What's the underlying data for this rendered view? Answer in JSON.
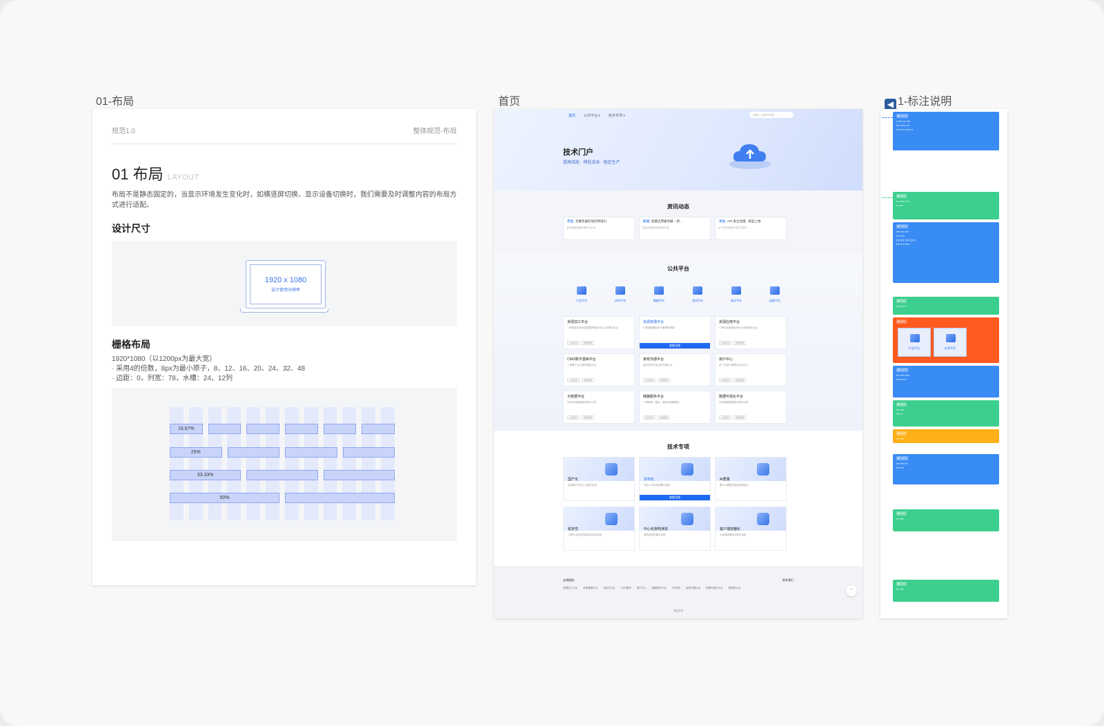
{
  "frames": {
    "layout_title": "01-布局",
    "home_title": "首页",
    "notes_title": "1-标注说明"
  },
  "layout": {
    "version": "规范1.0",
    "breadcrumb": "整体规范-布局",
    "heading": "01 布局",
    "heading_en": "LAYOUT",
    "description": "布局不是静态固定的，当显示环境发生变化时，如横竖屏切换、显示设备切换时，我们需要及时调整内容的布局方式进行适配。",
    "design_size_title": "设计尺寸",
    "resolution": "1920 x 1080",
    "resolution_sub": "设计使用分辨率",
    "grid_title": "栅格布局",
    "grid_lines": [
      "1920*1080（以1200px为最大宽）",
      "· 采用4的倍数，8px为最小原子，8、12、16、20、24、32、48",
      "· 边距：0，列宽：78，水槽：24，12列"
    ],
    "grid_labels": [
      "16.67%",
      "25%",
      "33.33%",
      "50%"
    ],
    "grid_fractions": [
      0.1667,
      0.25,
      0.3333,
      0.5
    ]
  },
  "home": {
    "nav": [
      "首页",
      "公共平台 ▾",
      "技术专项 ▾"
    ],
    "search_placeholder": "请输入关键字搜索",
    "hero_title": "技术门户",
    "hero_sub": "提高效能 · 降低成本 · 稳定生产",
    "news_title": "资讯动态",
    "news": [
      {
        "tag": "平台",
        "title": "云服务器在线迁移指引",
        "desc": "支持将服务器迁移至云平台"
      },
      {
        "tag": "新闻",
        "title": "轻量应用服务器 – 新…",
        "desc": "轻量应用服务器全新升级"
      },
      {
        "tag": "平台",
        "title": "API 安全治理 - 新品上线",
        "desc": "API 安全治理产品正式发布"
      }
    ],
    "platform_title": "公共平台",
    "platform_icons": [
      "产品平台",
      "技术平台",
      "数据平台",
      "测试平台",
      "安全平台",
      "运维平台"
    ],
    "platforms": [
      {
        "title": "资源加工平台",
        "desc": "一种将非结构化的数据资源进行加工处理的平台"
      },
      {
        "title": "资源管理平台",
        "desc": "可快速部署应用于管理的资源",
        "button": "查看详情"
      },
      {
        "title": "资源应用平台",
        "desc": "一种可将资源应用于业务场景的平台"
      },
      {
        "title": "CMO数字基础平台",
        "desc": "一种基于云计算的基础平台"
      },
      {
        "title": "家校沟通平台",
        "desc": "面向学校与家长的沟通平台"
      },
      {
        "title": "用户中心",
        "desc": "统一的用户管理与认证中心"
      },
      {
        "title": "大数据平台",
        "desc": "可支持海量数据存储与计算"
      },
      {
        "title": "链路服务平台",
        "desc": "一种简单、稳定、高效的链路服务"
      },
      {
        "title": "数据可视化平台",
        "desc": "可快速搭建数据可视化大屏"
      }
    ],
    "platform_tags": [
      "在线使用",
      "查看教程"
    ],
    "tech_title": "技术专项",
    "techs": [
      {
        "title": "国产化",
        "desc": "支持国产化芯片与操作系统"
      },
      {
        "title": "本地化",
        "desc": "专注于本地化部署与服务",
        "button": "查看详情"
      },
      {
        "title": "AI质量",
        "desc": "基于大模型的质量保障能力"
      },
      {
        "title": "稳定性",
        "desc": "了解平台稳定性建设的技术实践"
      },
      {
        "title": "中心化架构演进",
        "desc": "架构演进的最佳实践"
      },
      {
        "title": "客户端容器化",
        "desc": "大前端容器化实践与探索"
      }
    ],
    "footer_links_title": "友情链接",
    "footer_links": [
      "资源加工平台",
      "资源管理平台",
      "AI能力平台",
      "CMO基础",
      "用户中心",
      "链路服务平台",
      "API网关",
      "家校沟通平台",
      "数据可视化平台",
      "数据库平台"
    ],
    "footer_contact": "联系我们",
    "copyright": "版权信息"
  },
  "notes": {
    "back_icon": "arrow-left-icon"
  }
}
